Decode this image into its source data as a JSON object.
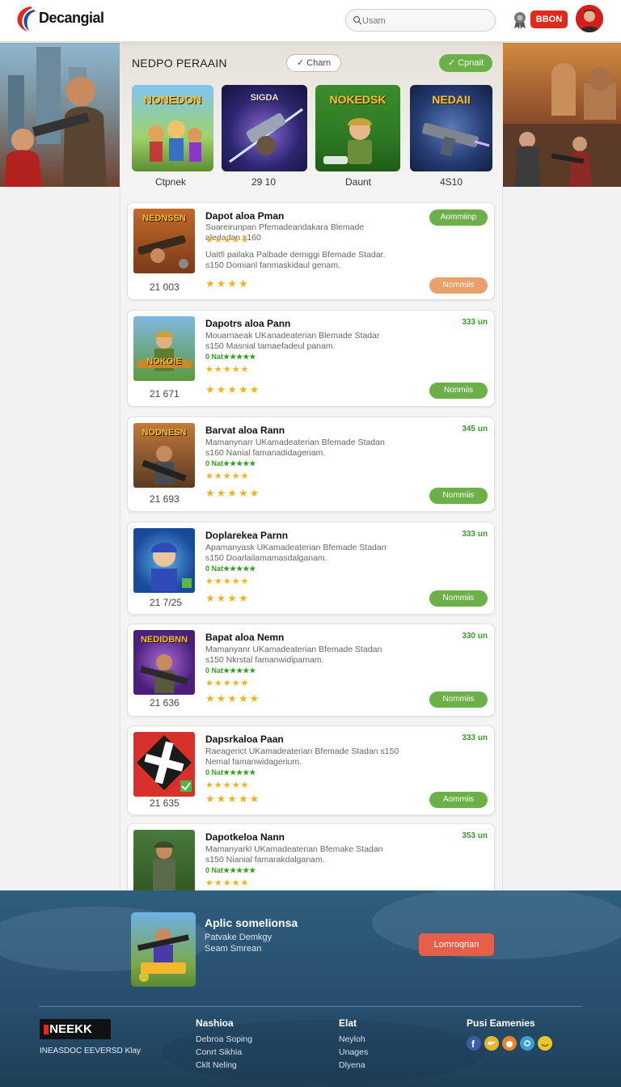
{
  "header": {
    "logo_text": "Decangial",
    "search_placeholder": "Usam",
    "red_button_label": "BBON"
  },
  "hero": {
    "section_title": "NEDPO PERAAIN",
    "outline_pill": "✓ Charn",
    "green_pill": "✓ Cpnait",
    "featured": [
      {
        "title": "NONEDON",
        "caption": "Ctpnek"
      },
      {
        "title": "SIGDA",
        "caption": "29 10"
      },
      {
        "title": "NOKEDSK",
        "caption": "Daunt"
      },
      {
        "title": "NEDAII",
        "caption": "4S10"
      }
    ]
  },
  "cards": [
    {
      "thumb_title": "NEDNSSN",
      "title": "Dapot aloa Pman",
      "desc1": "Suareirunpan Pfemadeandakara Blemade aledadan s160",
      "desc2": "Uaitfi pailaka Palbade demiggi Bfemade Stadar. s150 Domianl fanmaskidaul genam.",
      "stars": "★★★★★",
      "stars2": "★★★★",
      "count": "21 003",
      "button": "Aommiinp",
      "button2": "Nommiis"
    },
    {
      "thumb_title": "NOKOIE",
      "title": "Dapotrs aloa Pann",
      "desc": "Mouarnaeak UKanadeaterian Blemade Stadar s150 Masnial tamaefadeul panam.",
      "tag": "0 Nat★★★★★",
      "size": "333 un",
      "stars": "★★★★★",
      "stars2": "★★★★★",
      "count": "21 671",
      "button": "Nonmiis"
    },
    {
      "thumb_title": "NODNESN",
      "title": "Barvat aloa Rann",
      "desc": "Mamanynarr UKamadeaterian Bfemade Stadan s160 Nanial famanadidagenam.",
      "tag": "0 Nat★★★★★",
      "size": "345 un",
      "stars": "★★★★★",
      "stars2": "★★★★★",
      "count": "21 693",
      "button": "Nommiis"
    },
    {
      "thumb_title": "",
      "title": "Doplarekea Parnn",
      "desc": "Apamanyask UKamadeaterian Bfemade Stadan s150 Doarlailamamasdalganam.",
      "tag": "0 Nat★★★★★",
      "size": "333 un",
      "stars": "★★★★★",
      "stars2": "★★★★",
      "count": "21 7/25",
      "button": "Nommiis"
    },
    {
      "thumb_title": "NEDIDBNN",
      "title": "Bapat aloa Nemn",
      "desc": "Mamanyanr UKamadeaterian Bfemade Stadan s150 Nkrstal famanwidipamam.",
      "tag": "0 Nat★★★★★",
      "size": "330 un",
      "stars": "★★★★★",
      "stars2": "★★★★★",
      "count": "21 636",
      "button": "Nommiis"
    },
    {
      "thumb_title": "",
      "title": "Dapsrkaloa Paan",
      "desc": "Raeagerict UKamadeaterian Bfemade Stadan s150 Nemal famanwidagerium.",
      "tag": "0 Nat★★★★★",
      "size": "333 un",
      "stars": "★★★★★",
      "stars2": "★★★★★",
      "count": "21 635",
      "button": "Aommiis"
    },
    {
      "thumb_title": "",
      "title": "Dapotkeloa Nann",
      "desc": "Mamanyarkl UKamadeaterian Bfemake Stadan s150 Nianial famarakdalganam.",
      "tag": "0 Nat★★★★★",
      "size": "353 un",
      "stars": "★★★★★",
      "stars2": "",
      "count": "",
      "button": ""
    }
  ],
  "footer": {
    "promo_title": "Aplic somelionsa",
    "promo_line1": "Patvake Demkgy",
    "promo_line2": "Seam Smrean",
    "promo_button": "Lomroqrian",
    "logo_text": "NEEKK",
    "tagline": "INEASDOC EEVERSD Klay",
    "col1_head": "Nashioa",
    "col1_links": [
      "Debroa Soping",
      "Conrt Sikhia",
      "Cklt Neling"
    ],
    "col2_head": "Elat",
    "col2_links": [
      "Neyloh",
      "Unages",
      "Dlyena"
    ],
    "col3_head": "Pusi Eamenies"
  }
}
